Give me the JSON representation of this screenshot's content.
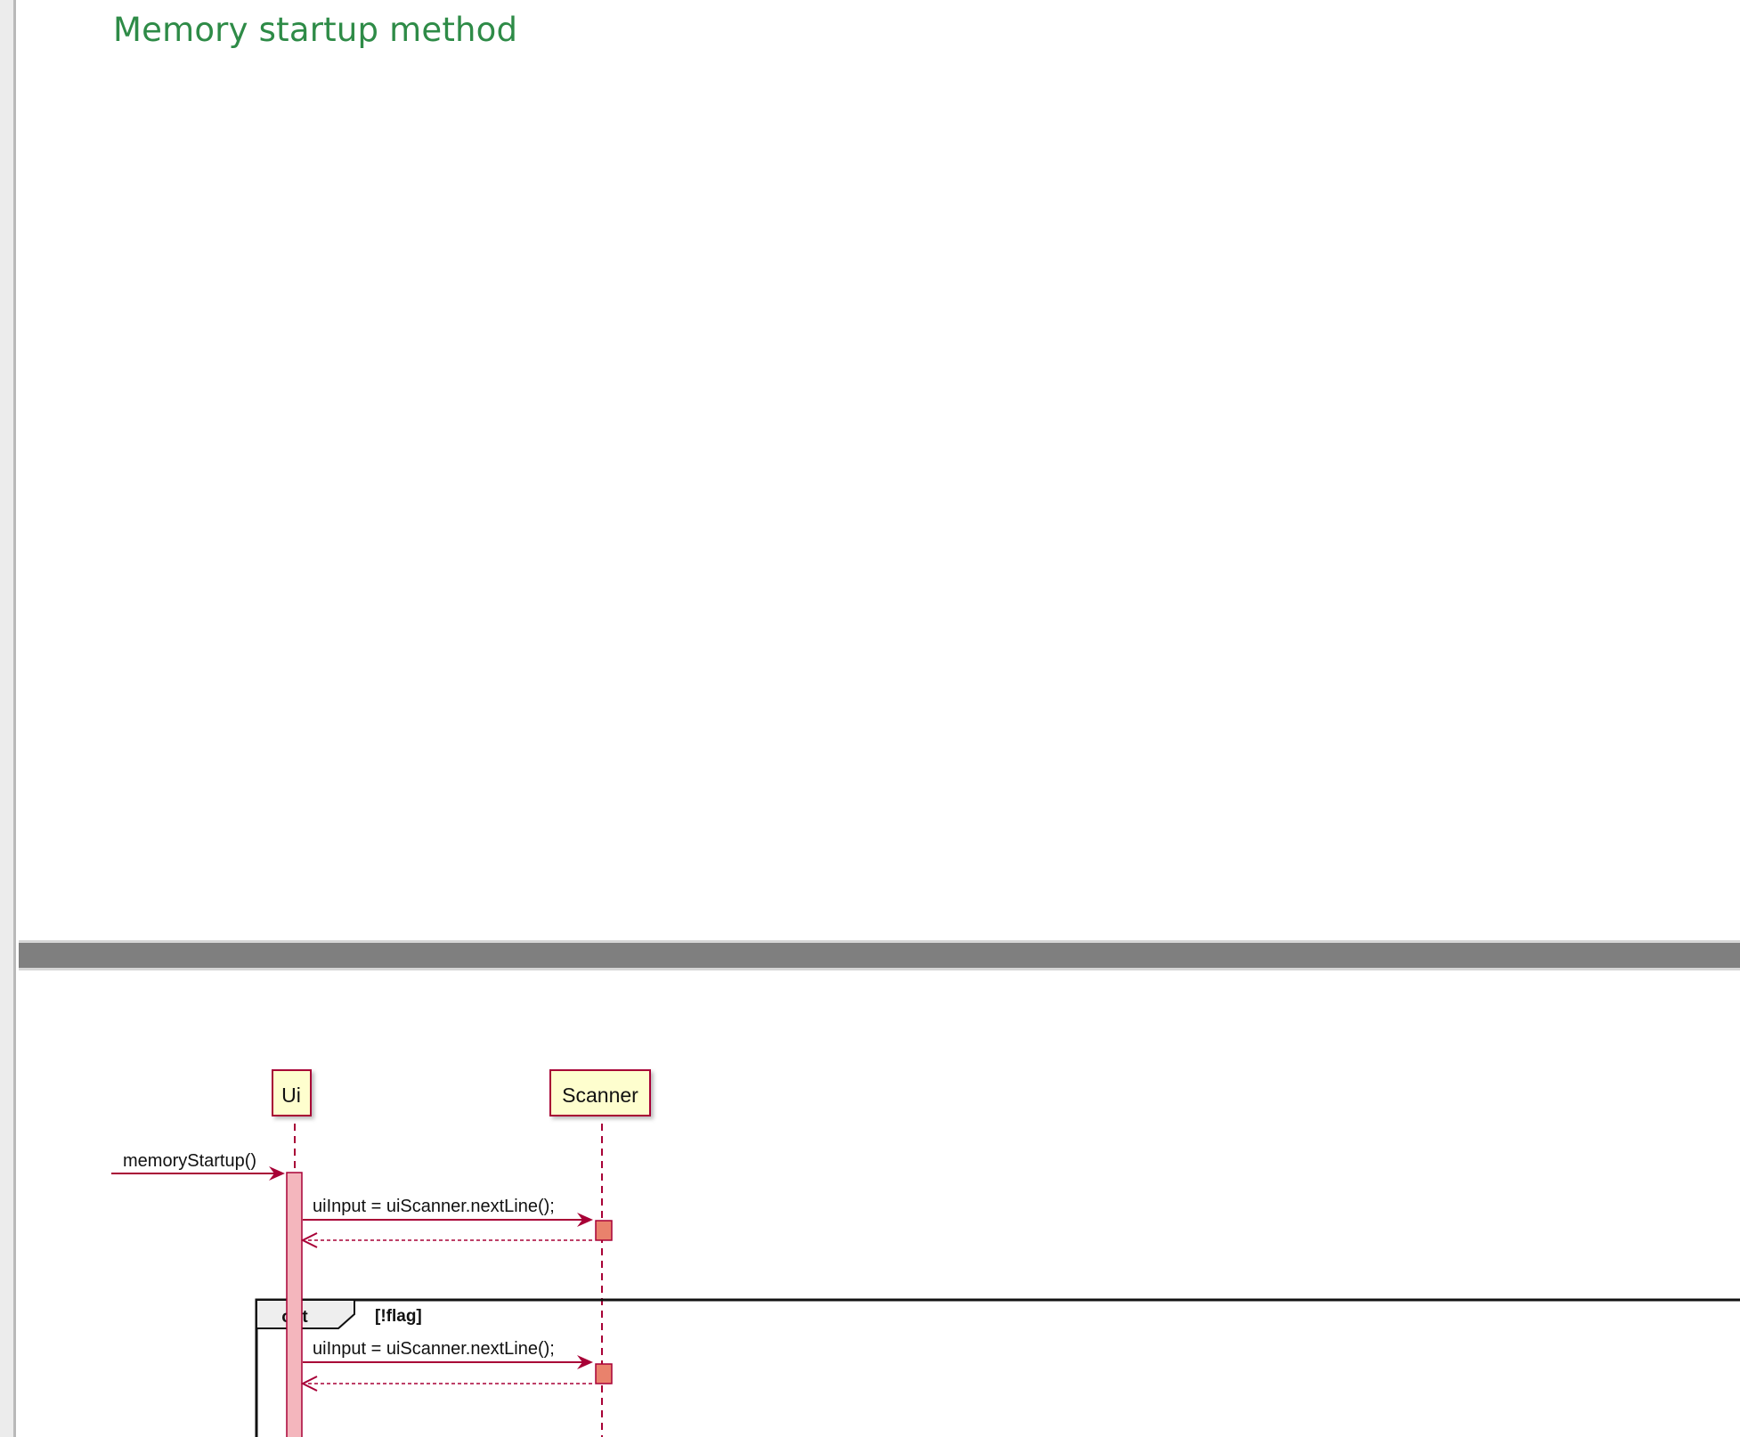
{
  "page": {
    "title": "Memory startup method"
  },
  "diagram": {
    "participants": [
      {
        "id": "ui",
        "label": "Ui"
      },
      {
        "id": "scanner",
        "label": "Scanner"
      }
    ],
    "messages": [
      {
        "from": "external",
        "to": "ui",
        "label": "memoryStartup()",
        "kind": "call"
      },
      {
        "from": "ui",
        "to": "scanner",
        "label": "uiInput = uiScanner.nextLine();",
        "kind": "call"
      },
      {
        "from": "scanner",
        "to": "ui",
        "label": "",
        "kind": "return"
      },
      {
        "from": "ui",
        "to": "scanner",
        "label": "uiInput = uiScanner.nextLine();",
        "kind": "call",
        "fragment": "opt"
      },
      {
        "from": "scanner",
        "to": "ui",
        "label": "",
        "kind": "return",
        "fragment": "opt"
      }
    ],
    "fragment": {
      "operator": "opt",
      "guard": "[!flag]"
    },
    "colors": {
      "participant_fill": "#fefece",
      "participant_border": "#a80036",
      "activation_ui": "#f4b6bd",
      "activation_scanner": "#e9826c",
      "arrow": "#a80036"
    }
  }
}
